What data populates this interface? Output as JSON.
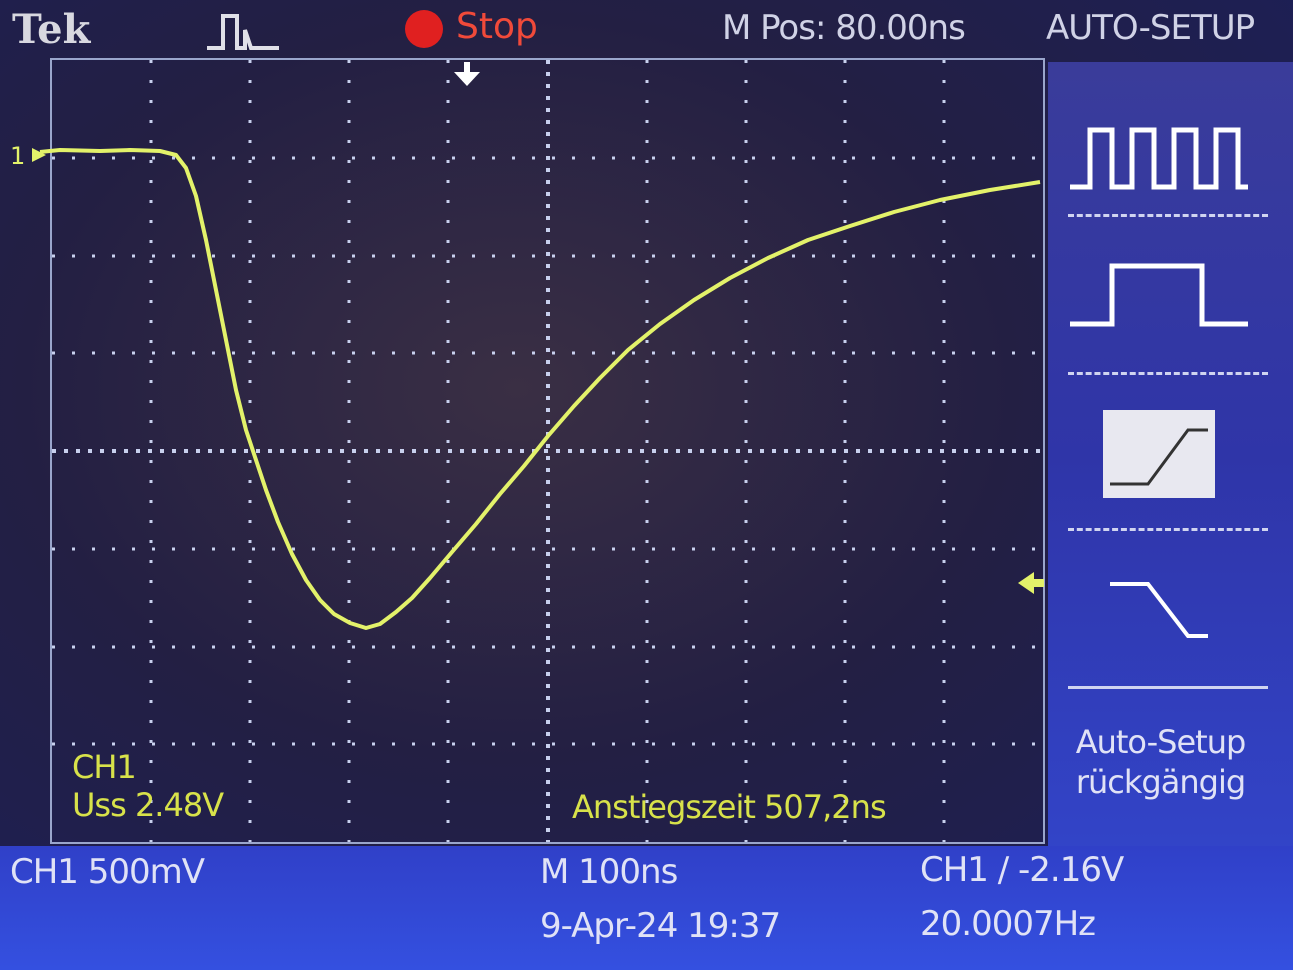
{
  "header": {
    "brand": "Tek",
    "acquire_icon": "pulse-icon",
    "run_state": "Stop",
    "horizontal_position": "M Pos: 80.00ns",
    "menu_title": "AUTO-SETUP"
  },
  "display": {
    "channel_marker": "1",
    "ch1_label": "CH1",
    "measurement_1": "Uss 2.48V",
    "measurement_2": "Anstiegszeit 507,2ns"
  },
  "menu": {
    "items": [
      {
        "icon": "multi-cycle-square-wave-icon"
      },
      {
        "icon": "single-cycle-pulse-icon"
      },
      {
        "icon": "rising-edge-icon"
      },
      {
        "icon": "falling-edge-icon"
      }
    ],
    "undo_line1": "Auto-Setup",
    "undo_line2": "rückgängig"
  },
  "footer": {
    "ch1_scale": "CH1  500mV",
    "timebase": "M 100ns",
    "trigger": "CH1  ∕  -2.16V",
    "date_time": "9-Apr-24 19:37",
    "frequency": "20.0007Hz"
  },
  "colors": {
    "trace": "#e3f26a",
    "accent_stop": "#e02020",
    "menu_bg": "#3244c8",
    "graticule": "#9aa6cc"
  }
}
